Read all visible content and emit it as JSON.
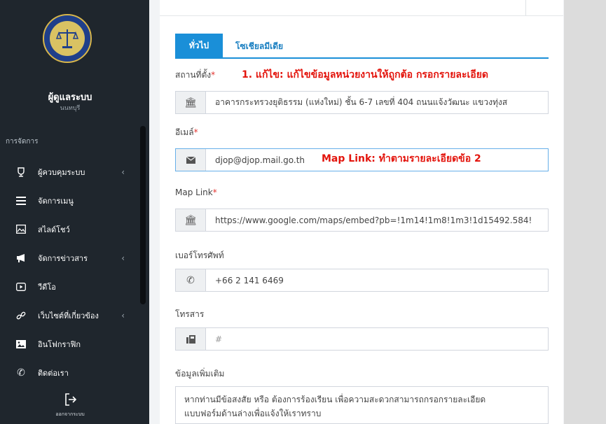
{
  "sidebar": {
    "user_name": "ผู้ดูแลระบบ",
    "user_location": "นนทบุรี",
    "section_label": "การจัดการ",
    "items": [
      {
        "label": "ผู้ควบคุมระบบ",
        "icon": "trophy-icon",
        "has_submenu": true
      },
      {
        "label": "จัดการเมนู",
        "icon": "menu-lines-icon",
        "has_submenu": false
      },
      {
        "label": "สไลด์โชว์",
        "icon": "image-icon",
        "has_submenu": false
      },
      {
        "label": "จัดการข่าวสาร",
        "icon": "megaphone-icon",
        "has_submenu": true
      },
      {
        "label": "วีดีโอ",
        "icon": "video-icon",
        "has_submenu": false
      },
      {
        "label": "เว็บไซต์ที่เกี่ยวข้อง",
        "icon": "link-icon",
        "has_submenu": true
      },
      {
        "label": "อินโฟกราฟิก",
        "icon": "picture-icon",
        "has_submenu": false
      },
      {
        "label": "ติดต่อเรา",
        "icon": "phone-icon",
        "has_submenu": false
      }
    ],
    "logout_label": "ออกจากระบบ",
    "logout_icon": "logout-icon"
  },
  "tabs": {
    "general": "ทั่วไป",
    "social": "โซเชียลมีเดีย"
  },
  "form": {
    "address": {
      "label": "สถานที่ตั้ง",
      "required": "*",
      "value": "อาคารกระทรวงยุติธรรม (แห่งใหม่) ชั้น 6-7 เลขที่ 404 ถนนแจ้งวัฒนะ แขวงทุ่งส",
      "icon": "building-icon"
    },
    "email": {
      "label": "อีเมล์",
      "required": "*",
      "value": "djop@djop.mail.go.th",
      "icon": "envelope-icon"
    },
    "map_link": {
      "label": "Map Link",
      "required": "*",
      "value": "https://www.google.com/maps/embed?pb=!1m14!1m8!1m3!1d15492.584!",
      "icon": "building-icon"
    },
    "phone": {
      "label": "เบอร์โทรศัพท์",
      "value": "+66 2 141 6469",
      "icon": "phone-icon"
    },
    "fax": {
      "label": "โทรสาร",
      "placeholder": "#",
      "icon": "fax-icon"
    },
    "extra": {
      "label": "ข้อมูลเพิ่มเติม",
      "value_line1": "หากท่านมีข้อสงสัย หรือ ต้องการร้องเรียน เพื่อความสะดวกสามารถกรอกรายละเอียด",
      "value_line2": "แบบฟอร์มด้านล่างเพื่อแจ้งให้เราทราบ"
    }
  },
  "annotations": {
    "note1": "1. แก้ไข: แก้ไขข้อมูลหน่วยงานให้ถูกต้อ กรอกรายละเอียด",
    "note2": "Map Link: ทำตามรายละเอียดข้อ 2"
  },
  "colors": {
    "sidebar": "#1f262d",
    "accent": "#1a8fd8",
    "annotation": "#e3140c"
  }
}
